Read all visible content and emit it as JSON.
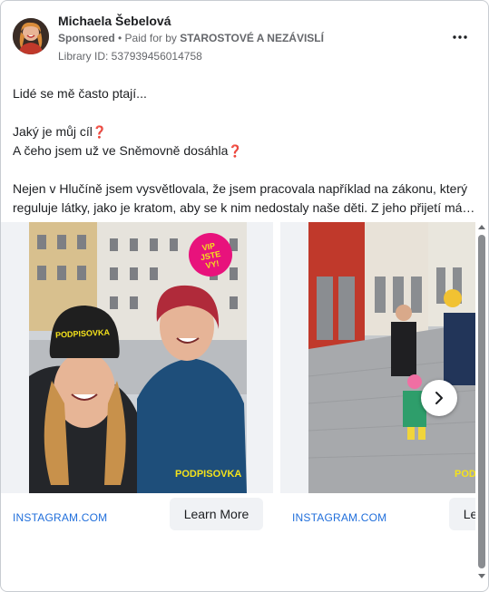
{
  "header": {
    "advertiser_name": "Michaela Šebelová",
    "sponsored": "Sponsored",
    "paid_for_prefix": "• Paid for by",
    "payer": "STAROSTOVÉ A NEZÁVISLÍ",
    "library_id": "Library ID: 537939456014758",
    "more_icon": "more-horizontal-icon"
  },
  "post": {
    "line1": "Lidé se mě často ptají...",
    "line2": "Jaký je můj cíl",
    "line3": "A čeho jsem už ve Sněmovně dosáhla",
    "line4": "Nejen v Hlučíně jsem vysvětlovala, že jsem pracovala například na zákonu, který",
    "line5": "reguluje látky, jako je kratom, aby se k nim nedostaly naše děti. Z jeho přijetí mám…",
    "question_mark": "❓"
  },
  "carousel": {
    "cards": [
      {
        "domain": "INSTAGRAM.COM",
        "cta": "Learn More",
        "sticker": "VIP JSTE VY!",
        "hat_text": "PODPISOVKA",
        "watermark": "PODPISOVKA"
      },
      {
        "domain": "INSTAGRAM.COM",
        "cta": "Learn More",
        "watermark": "POD"
      }
    ],
    "next_icon": "chevron-right-icon"
  },
  "colors": {
    "link": "#216fdb",
    "muted": "#65676b",
    "accent_pink": "#e0245e",
    "sticker": "#e8127c",
    "watermark": "#f4e21b"
  }
}
